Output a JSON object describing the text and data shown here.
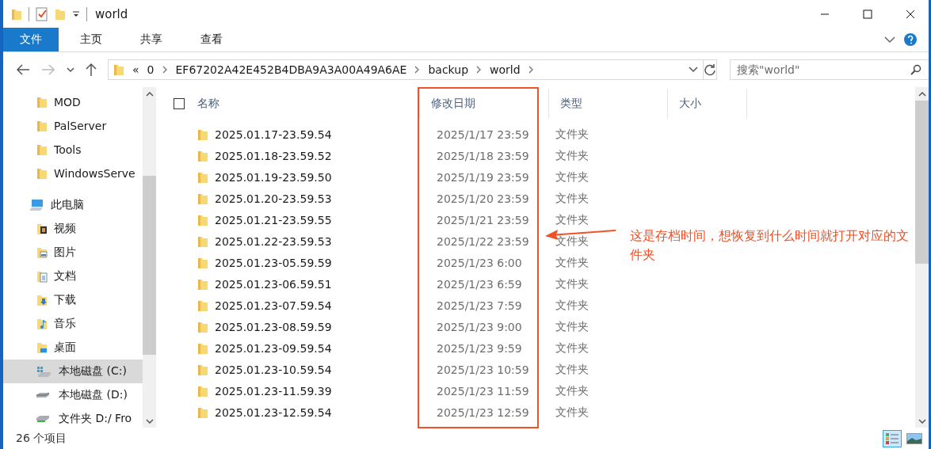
{
  "window": {
    "title": "world"
  },
  "ribbon": {
    "tabs": [
      {
        "label": "文件",
        "selected": true
      },
      {
        "label": "主页",
        "selected": false
      },
      {
        "label": "共享",
        "selected": false
      },
      {
        "label": "查看",
        "selected": false
      }
    ]
  },
  "address": {
    "overflow": "«",
    "path": [
      "0",
      "EF67202A42E452B4DBA9A3A00A49A6AE",
      "backup",
      "world"
    ],
    "search": {
      "placeholder": "搜索\"world\""
    }
  },
  "sidebar": {
    "items": [
      {
        "label": "MOD",
        "kind": "folder",
        "selected": false
      },
      {
        "label": "PalServer",
        "kind": "folder",
        "selected": false
      },
      {
        "label": "Tools",
        "kind": "folder",
        "selected": false
      },
      {
        "label": "WindowsServe",
        "kind": "folder",
        "selected": false
      },
      {
        "label": "此电脑",
        "kind": "pc",
        "selected": false
      },
      {
        "label": "视频",
        "kind": "video",
        "selected": false
      },
      {
        "label": "图片",
        "kind": "pictures",
        "selected": false
      },
      {
        "label": "文档",
        "kind": "documents",
        "selected": false
      },
      {
        "label": "下载",
        "kind": "downloads",
        "selected": false
      },
      {
        "label": "音乐",
        "kind": "music",
        "selected": false
      },
      {
        "label": "桌面",
        "kind": "desktop",
        "selected": false
      },
      {
        "label": "本地磁盘 (C:)",
        "kind": "system-drive",
        "selected": true
      },
      {
        "label": "本地磁盘 (D:)",
        "kind": "drive",
        "selected": false
      },
      {
        "label": "文件夹 D:/ Fro",
        "kind": "network-drive",
        "selected": false
      }
    ]
  },
  "table": {
    "select_all_checked": false,
    "columns": [
      "名称",
      "修改日期",
      "类型",
      "大小"
    ],
    "rows": [
      {
        "name": "2025.01.17-23.59.54",
        "date": "2025/1/17 23:59",
        "type": "文件夹"
      },
      {
        "name": "2025.01.18-23.59.52",
        "date": "2025/1/18 23:59",
        "type": "文件夹"
      },
      {
        "name": "2025.01.19-23.59.50",
        "date": "2025/1/19 23:59",
        "type": "文件夹"
      },
      {
        "name": "2025.01.20-23.59.53",
        "date": "2025/1/20 23:59",
        "type": "文件夹"
      },
      {
        "name": "2025.01.21-23.59.55",
        "date": "2025/1/21 23:59",
        "type": "文件夹"
      },
      {
        "name": "2025.01.22-23.59.53",
        "date": "2025/1/22 23:59",
        "type": "文件夹"
      },
      {
        "name": "2025.01.23-05.59.59",
        "date": "2025/1/23 6:00",
        "type": "文件夹"
      },
      {
        "name": "2025.01.23-06.59.51",
        "date": "2025/1/23 6:59",
        "type": "文件夹"
      },
      {
        "name": "2025.01.23-07.59.54",
        "date": "2025/1/23 7:59",
        "type": "文件夹"
      },
      {
        "name": "2025.01.23-08.59.59",
        "date": "2025/1/23 9:00",
        "type": "文件夹"
      },
      {
        "name": "2025.01.23-09.59.54",
        "date": "2025/1/23 9:59",
        "type": "文件夹"
      },
      {
        "name": "2025.01.23-10.59.54",
        "date": "2025/1/23 10:59",
        "type": "文件夹"
      },
      {
        "name": "2025.01.23-11.59.39",
        "date": "2025/1/23 11:59",
        "type": "文件夹"
      },
      {
        "name": "2025.01.23-12.59.54",
        "date": "2025/1/23 12:59",
        "type": "文件夹"
      }
    ]
  },
  "annotation": {
    "text": "这是存档时间，想恢复到什么时间就打开对应的文件夹"
  },
  "status_bar": {
    "count": "26 个项目"
  }
}
